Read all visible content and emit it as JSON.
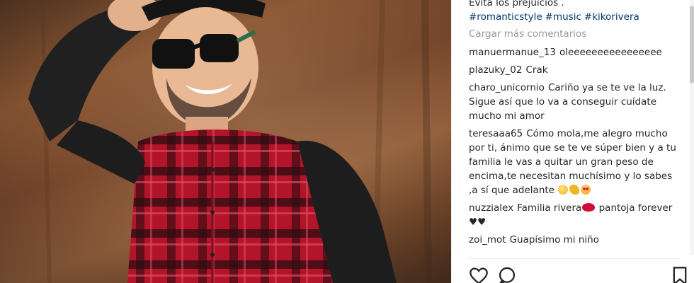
{
  "photo": {
    "subject": "man in checked shirt and sunglasses",
    "shirt_color": "#b3142a",
    "wall_color": "#7a4a2e"
  },
  "post": {
    "caption_tail": "Evita los prejuicios .",
    "hashtags": [
      "#romanticstyle",
      "#music",
      "#kikorivera"
    ],
    "load_more_label": "Cargar más comentarios",
    "comments": [
      {
        "user": "manuermanue_13",
        "text": "oleeeeeeeeeeeeeeee"
      },
      {
        "user": "plazuky_02",
        "text": "Crak"
      },
      {
        "user": "charo_unicornio",
        "text": "Cariño ya se te ve la luz. Sigue así que lo va a conseguir cuídate mucho mi amor"
      },
      {
        "user": "teresaaa65",
        "text": "Cómo mola,me alegro mucho por ti, ánimo que se te ve súper bien y a tu familia le vas a quitar un gran peso de encima,te necesitan muchísimo y lo sabes ,a sí que adelante"
      },
      {
        "user": "nuzzialex",
        "text": "Familia rivera",
        "text2": "pantoja forever",
        "text3": "♥♥"
      },
      {
        "user": "zoi_mot",
        "text": "Guapísimo mi niño"
      }
    ]
  },
  "actions": {
    "like_icon": "heart-outline-icon",
    "comment_icon": "speech-bubble-icon",
    "save_icon": "bookmark-icon"
  },
  "colors": {
    "link_blue": "#003569",
    "muted_gray": "#999999",
    "text": "#262626"
  }
}
